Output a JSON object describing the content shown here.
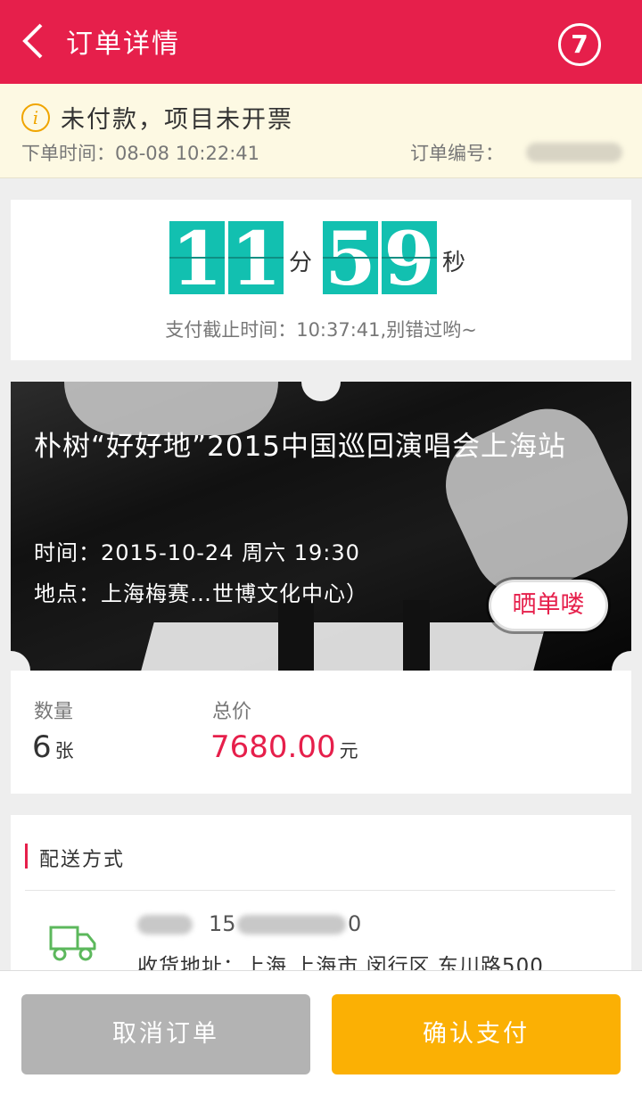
{
  "header": {
    "title": "订单详情",
    "badge": "7",
    "back_icon": "chevron-left-icon",
    "color": "#e61f4b"
  },
  "status": {
    "icon": "info-icon",
    "title": "未付款，项目未开票",
    "order_time": "下单时间：08-08 10:22:41",
    "order_no_label": "订单编号："
  },
  "countdown": {
    "minutes": [
      "1",
      "1"
    ],
    "min_unit": "分",
    "seconds": [
      "5",
      "9"
    ],
    "sec_unit": "秒",
    "deadline": "支付截止时间：10:37:41,别错过哟~",
    "digit_color": "#12c0b0"
  },
  "event": {
    "title": "朴树“好好地”2015中国巡回演唱会上海站",
    "time": "时间：2015-10-24 周六 19:30",
    "venue": "地点：上海梅赛…世博文化中心）",
    "share_label": "晒单喽"
  },
  "order": {
    "qty_label": "数量",
    "qty_value": "6",
    "qty_unit": "张",
    "price_label": "总价",
    "price_value": "7680.00",
    "price_unit": "元"
  },
  "delivery": {
    "section_title": "配送方式",
    "icon": "truck-icon",
    "phone_prefix": "15",
    "phone_suffix": "0",
    "address": "收货地址：上海 上海市 闵行区 东川路500"
  },
  "actions": {
    "cancel_label": "取消订单",
    "pay_label": "确认支付",
    "cancel_color": "#b3b3b3",
    "pay_color": "#fbb004"
  }
}
